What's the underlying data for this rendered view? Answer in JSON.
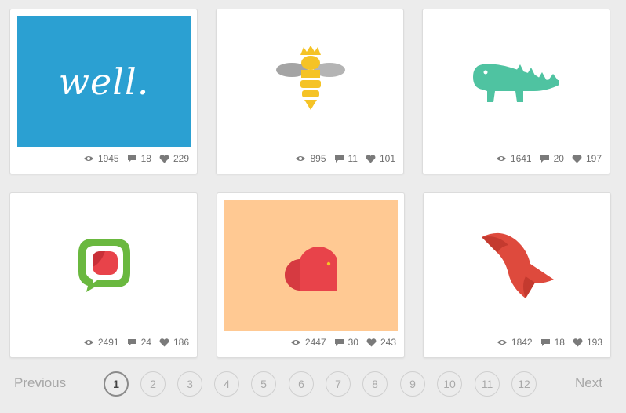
{
  "colors": {
    "page_background": "#ececec",
    "well_blue": "#2ba0d2",
    "bee_yellow": "#f5c326",
    "croc_green": "#4fc3a1",
    "chat_green": "#6ab83f",
    "heart_red": "#e8434a",
    "peach": "#ffc993",
    "goat_red": "#de4a3d"
  },
  "cards": [
    {
      "logo": "well-wordmark",
      "logo_text": "well.",
      "views": "1945",
      "comments": "18",
      "likes": "229"
    },
    {
      "logo": "bee-with-crown-logo",
      "views": "895",
      "comments": "11",
      "likes": "101"
    },
    {
      "logo": "crocodile-logo",
      "views": "1641",
      "comments": "20",
      "likes": "197"
    },
    {
      "logo": "speech-bubble-logo",
      "views": "2491",
      "comments": "24",
      "likes": "186"
    },
    {
      "logo": "heart-door-logo",
      "views": "2447",
      "comments": "30",
      "likes": "243"
    },
    {
      "logo": "goat-head-logo",
      "views": "1842",
      "comments": "18",
      "likes": "193"
    }
  ],
  "pagination": {
    "previous_label": "Previous",
    "next_label": "Next",
    "current_page": "1",
    "pages": [
      "1",
      "2",
      "3",
      "4",
      "5",
      "6",
      "7",
      "8",
      "9",
      "10",
      "11",
      "12"
    ]
  },
  "icons": {
    "views": "eye-icon",
    "comments": "speech-bubble-icon",
    "likes": "heart-icon"
  }
}
